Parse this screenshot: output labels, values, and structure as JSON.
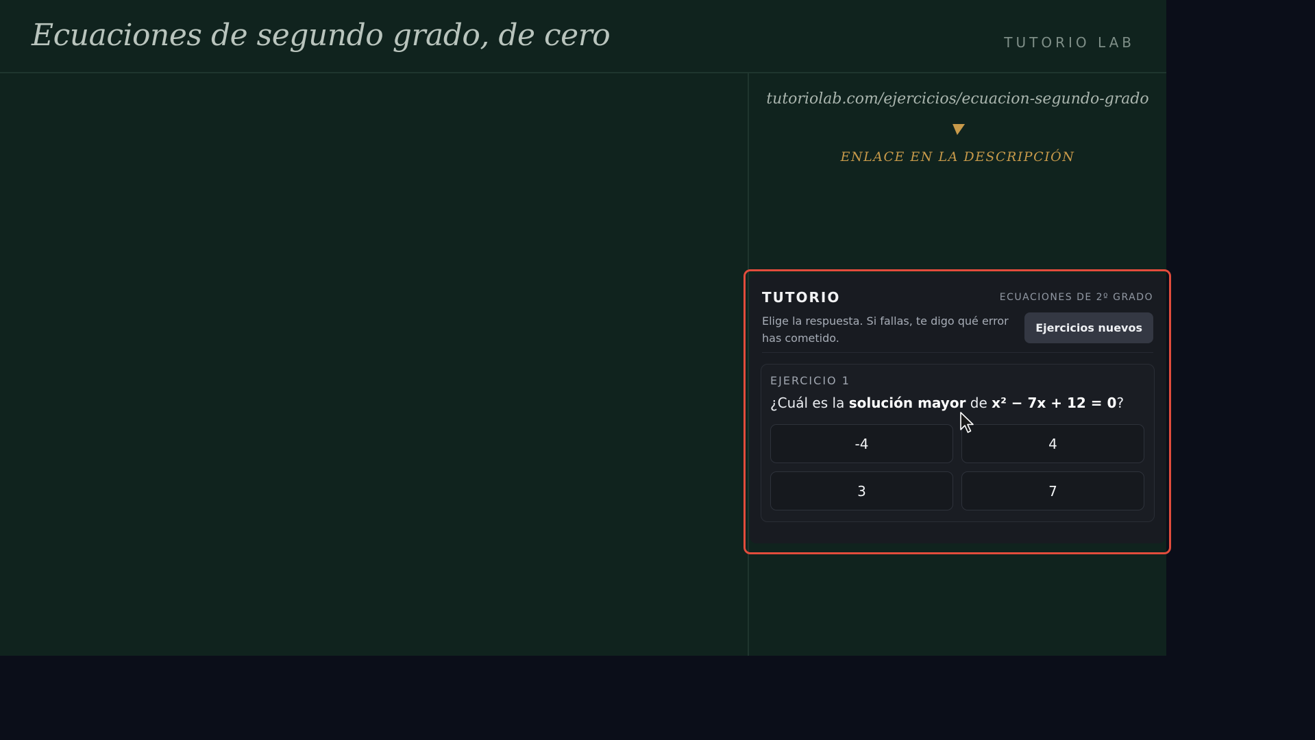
{
  "header": {
    "title": "Ecuaciones de segundo grado, de cero",
    "brand": "TUTORIO LAB"
  },
  "promo": {
    "url": "tutoriolab.com/ejercicios/ecuacion-segundo-grado",
    "arrow_icon": "arrow-down-icon",
    "cta": "ENLACE EN LA DESCRIPCIÓN"
  },
  "widget": {
    "title": "TUTORIO",
    "topic": "ECUACIONES DE 2º GRADO",
    "instructions": "Elige la respuesta. Si fallas, te digo qué error has cometido.",
    "new_exercises_label": "Ejercicios nuevos",
    "highlight_color": "#e24c3c",
    "exercise": {
      "label": "EJERCICIO 1",
      "question_prefix": "¿Cuál es la ",
      "question_emph": "solución mayor",
      "question_mid": " de ",
      "question_equation": "x² − 7x + 12 = 0",
      "question_suffix": "?",
      "options": [
        "-4",
        "4",
        "3",
        "7"
      ]
    }
  },
  "colors": {
    "stage_bg": "#10231e",
    "outer_bg": "#0b0e19",
    "accent_gold": "#c89a4a",
    "panel_bg": "#181b21"
  }
}
